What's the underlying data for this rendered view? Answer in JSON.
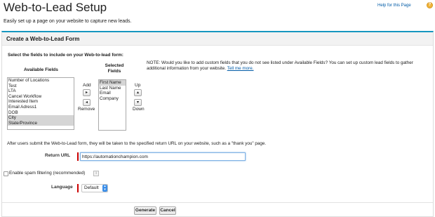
{
  "page": {
    "title": "Web-to-Lead Setup",
    "help_label": "Help for this Page",
    "subtitle": "Easily set up a page on your website to capture new leads."
  },
  "panel": {
    "title": "Create a Web-to-Lead Form",
    "select_instruction": "Select the fields to include on your Web-to-lead form:",
    "available_label": "Available Fields",
    "selected_label": "Selected Fields",
    "add_label": "Add",
    "remove_label": "Remove",
    "up_label": "Up",
    "down_label": "Down",
    "available_fields": [
      {
        "label": "Number of Locations",
        "selected": false
      },
      {
        "label": "Test",
        "selected": false
      },
      {
        "label": "LTA",
        "selected": false
      },
      {
        "label": "Cancel Workflow",
        "selected": false
      },
      {
        "label": "Interested Item",
        "selected": false
      },
      {
        "label": "Email Adress1",
        "selected": false
      },
      {
        "label": "DOB",
        "selected": false
      },
      {
        "label": "City",
        "selected": true
      },
      {
        "label": "State/Province",
        "selected": true
      }
    ],
    "selected_fields": [
      {
        "label": "First Name",
        "selected": true
      },
      {
        "label": "Last Name",
        "selected": false
      },
      {
        "label": "Email",
        "selected": false
      },
      {
        "label": "Company",
        "selected": false
      }
    ],
    "note_text": "NOTE: Would you like to add custom fields that you do not see listed under Available Fields? You can set up custom lead fields to gather additional information from your website.",
    "note_link": "Tell me more."
  },
  "form": {
    "after_submit_text": "After users submit the Web-to-Lead form, they will be taken to the specified return URL on your website, such as a \"thank you\" page.",
    "return_url_label": "Return URL",
    "return_url_value": "https://automationchampion.com",
    "spam_label": "Enable spam filtering (recommended)",
    "spam_checked": false,
    "info_icon_glyph": "i",
    "language_label": "Language",
    "language_value": "Default"
  },
  "buttons": {
    "generate_label": "Generate",
    "cancel_label": "Cancel"
  },
  "colors": {
    "panel_accent": "#1797c0",
    "link": "#015ba7",
    "required": "#cc0000",
    "help_icon": "#f0b43c"
  }
}
